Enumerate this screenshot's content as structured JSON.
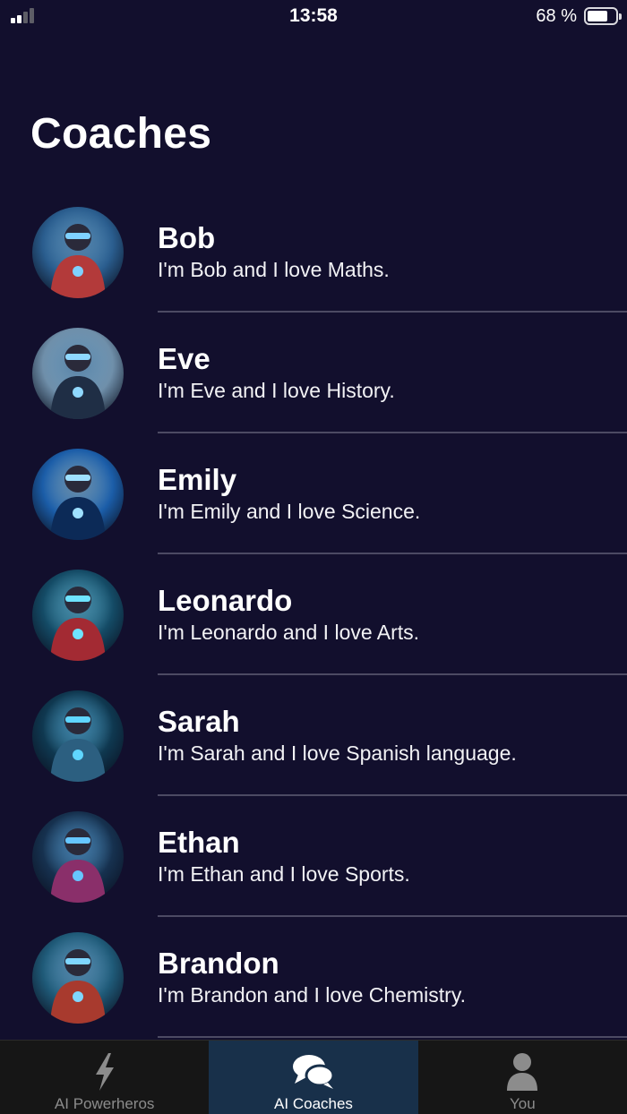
{
  "status_bar": {
    "time": "13:58",
    "battery": "68 %"
  },
  "page": {
    "title": "Coaches"
  },
  "coaches": [
    {
      "name": "Bob",
      "description": "I'm Bob and I love Maths.",
      "avatar_colors": [
        "#2a5d8e",
        "#b33a3a",
        "#7fd1ff"
      ]
    },
    {
      "name": "Eve",
      "description": "I'm Eve and I love History.",
      "avatar_colors": [
        "#6f8faa",
        "#1f2e45",
        "#8fd8ff"
      ]
    },
    {
      "name": "Emily",
      "description": "I'm Emily and I love Science.",
      "avatar_colors": [
        "#1b5da8",
        "#0c2a57",
        "#9fe0ff"
      ]
    },
    {
      "name": "Leonardo",
      "description": "I'm Leonardo and I love Arts.",
      "avatar_colors": [
        "#144b66",
        "#a32a33",
        "#6ee3ff"
      ]
    },
    {
      "name": "Sarah",
      "description": "I'm Sarah and I love Spanish language.",
      "avatar_colors": [
        "#0f3850",
        "#2c5f80",
        "#60d6ff"
      ]
    },
    {
      "name": "Ethan",
      "description": "I'm Ethan and I love Sports.",
      "avatar_colors": [
        "#16314f",
        "#8a2f6a",
        "#66c6ff"
      ]
    },
    {
      "name": "Brandon",
      "description": "I'm Brandon and I love Chemistry.",
      "avatar_colors": [
        "#1f5a78",
        "#a83a2e",
        "#7fd6ff"
      ]
    }
  ],
  "tab_bar": {
    "tabs": [
      {
        "label": "AI Powerheros",
        "icon": "bolt-icon",
        "active": false
      },
      {
        "label": "AI Coaches",
        "icon": "chat-bubbles-icon",
        "active": true
      },
      {
        "label": "You",
        "icon": "person-icon",
        "active": false
      }
    ]
  },
  "colors": {
    "background": "#120f2d",
    "divider": "#4c4a63",
    "tab_bar": "#161616",
    "tab_active": "#18304a",
    "tab_inactive_text": "#8c8c8c"
  }
}
